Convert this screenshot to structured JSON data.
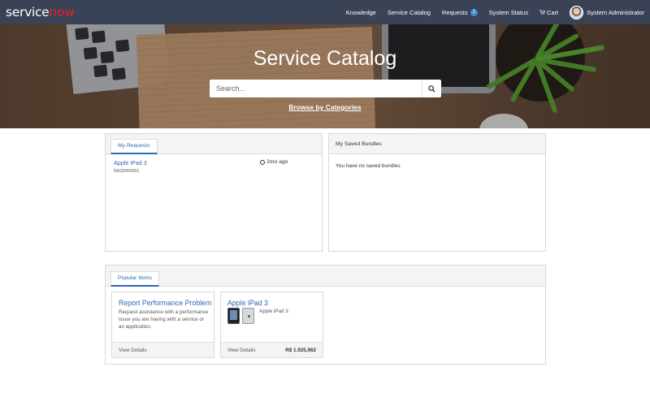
{
  "brand": {
    "logo_left": "service",
    "logo_right": "now"
  },
  "nav": {
    "knowledge": "Knowledge",
    "catalog": "Service Catalog",
    "requests": "Requests",
    "requests_count": "1",
    "status": "System Status",
    "cart": "Cart",
    "user": "System Administrator"
  },
  "hero": {
    "title": "Service Catalog",
    "search_placeholder": "Search...",
    "browse_link": "Browse by Categories"
  },
  "my_requests": {
    "tab_label": "My Requests",
    "items": [
      {
        "name": "Apple iPad 3",
        "number": "REQ0000001",
        "time": "2mo ago"
      }
    ]
  },
  "saved_bundles": {
    "title": "My Saved Bundles",
    "empty_text": "You have no saved bundles"
  },
  "popular": {
    "tab_label": "Popular Items",
    "items": [
      {
        "title": "Report Performance Problem",
        "description": "Request assistance with a performance issue you are having with a service or an application.",
        "link": "View Details",
        "price": ""
      },
      {
        "title": "Apple iPad 3",
        "description": "Apple iPad 3",
        "link": "View Details",
        "price": "R$ 1.925,962"
      }
    ]
  },
  "colors": {
    "nav_bg": "#3a4356",
    "accent": "#2d6bb8",
    "logo_red": "#e8202a",
    "badge": "#3b8fd6"
  }
}
